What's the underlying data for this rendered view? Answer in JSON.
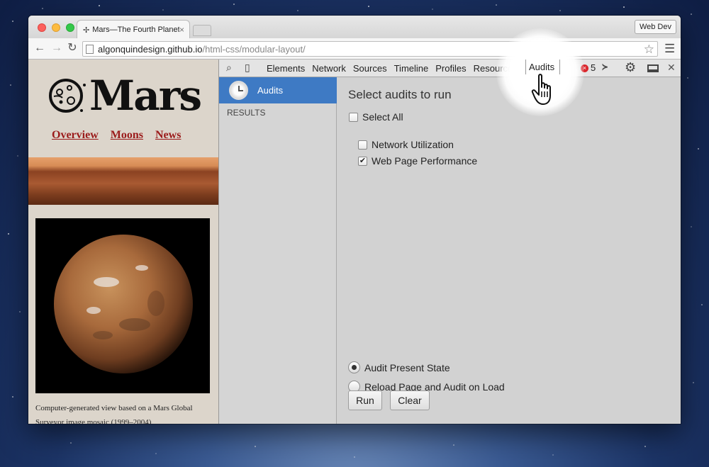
{
  "browser": {
    "tab_title": "Mars—The Fourth Planet",
    "tab_icon": "✢",
    "profile_label": "Web Dev",
    "url_host": "algonquindesign.github.io",
    "url_path": "/html-css/modular-layout/"
  },
  "page": {
    "logo_text": "Mars",
    "nav": [
      "Overview",
      "Moons",
      "News"
    ],
    "caption": "Computer-generated view based on a Mars Global Surveyor image mosaic (1999–2004)"
  },
  "devtools": {
    "tabs": [
      "Elements",
      "Network",
      "Sources",
      "Timeline",
      "Profiles",
      "Resources",
      "Audits"
    ],
    "active_tab": "Audits",
    "error_count": "5",
    "sidebar": {
      "active_item": "Audits",
      "results_label": "RESULTS"
    },
    "audits": {
      "heading": "Select audits to run",
      "select_all": "Select All",
      "options": [
        {
          "label": "Network Utilization",
          "checked": false
        },
        {
          "label": "Web Page Performance",
          "checked": true
        }
      ],
      "radio_present": "Audit Present State",
      "radio_reload": "Reload Page and Audit on Load",
      "run_label": "Run",
      "clear_label": "Clear"
    }
  }
}
